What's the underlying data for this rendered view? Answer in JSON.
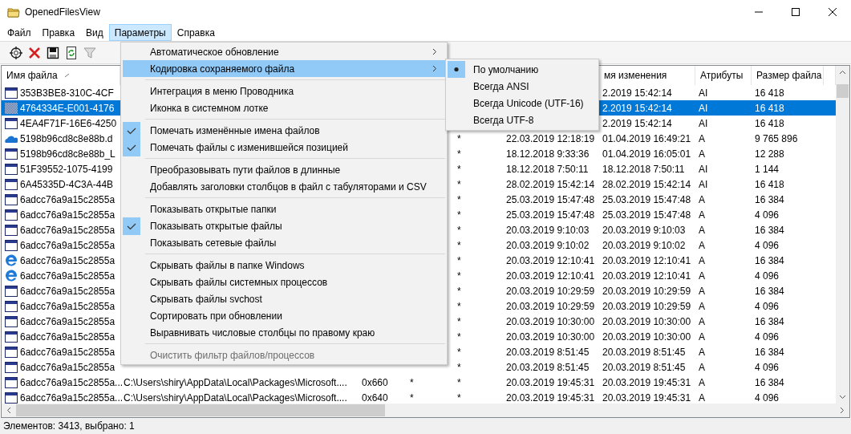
{
  "window": {
    "title": "OpenedFilesView"
  },
  "menu_bar": [
    {
      "label": "Файл",
      "selected": false
    },
    {
      "label": "Правка",
      "selected": false
    },
    {
      "label": "Вид",
      "selected": false
    },
    {
      "label": "Параметры",
      "selected": true
    },
    {
      "label": "Справка",
      "selected": false
    }
  ],
  "menu": {
    "items": [
      {
        "kind": "submenu",
        "label": "Автоматическое обновление",
        "selected": false
      },
      {
        "kind": "submenu",
        "label": "Кодировка сохраняемого файла",
        "selected": true
      },
      {
        "kind": "separator"
      },
      {
        "kind": "item",
        "label": "Интеграция в меню Проводника",
        "checked": false,
        "selected": false,
        "disabled": false
      },
      {
        "kind": "item",
        "label": "Иконка в системном лотке",
        "checked": false,
        "selected": false,
        "disabled": false
      },
      {
        "kind": "separator"
      },
      {
        "kind": "item",
        "label": "Помечать изменённые имена файлов",
        "checked": true,
        "selected": false,
        "disabled": false
      },
      {
        "kind": "item",
        "label": "Помечать файлы с изменившейся позицией",
        "checked": true,
        "selected": false,
        "disabled": false
      },
      {
        "kind": "separator"
      },
      {
        "kind": "item",
        "label": "Преобразовывать пути файлов в длинные",
        "checked": false,
        "selected": false,
        "disabled": false
      },
      {
        "kind": "item",
        "label": "Добавлять заголовки столбцов в файл с табуляторами и CSV",
        "checked": false,
        "selected": false,
        "disabled": false
      },
      {
        "kind": "separator"
      },
      {
        "kind": "item",
        "label": "Показывать открытые папки",
        "checked": false,
        "selected": false,
        "disabled": false
      },
      {
        "kind": "item",
        "label": "Показывать открытые файлы",
        "checked": true,
        "selected": false,
        "disabled": false
      },
      {
        "kind": "item",
        "label": "Показывать сетевые файлы",
        "checked": false,
        "selected": false,
        "disabled": false
      },
      {
        "kind": "separator"
      },
      {
        "kind": "item",
        "label": "Скрывать файлы в папке Windows",
        "checked": false,
        "selected": false,
        "disabled": false
      },
      {
        "kind": "item",
        "label": "Скрывать файлы системных процессов",
        "checked": false,
        "selected": false,
        "disabled": false
      },
      {
        "kind": "item",
        "label": "Скрывать файлы svchost",
        "checked": false,
        "selected": false,
        "disabled": false
      },
      {
        "kind": "item",
        "label": "Сортировать при обновлении",
        "checked": false,
        "selected": false,
        "disabled": false
      },
      {
        "kind": "item",
        "label": "Выравнивать числовые столбцы по правому краю",
        "checked": false,
        "selected": false,
        "disabled": false
      },
      {
        "kind": "separator"
      },
      {
        "kind": "item",
        "label": "Очистить фильтр файлов/процессов",
        "checked": false,
        "selected": false,
        "disabled": true
      }
    ]
  },
  "submenu": {
    "items": [
      {
        "label": "По умолчанию",
        "selected": true
      },
      {
        "label": "Всегда ANSI",
        "selected": false
      },
      {
        "label": "Всегда Unicode (UTF-16)",
        "selected": false
      },
      {
        "label": "Всегда UTF-8",
        "selected": false
      }
    ]
  },
  "table": {
    "columns": [
      {
        "label": "Имя файла",
        "sorted": true
      },
      {
        "label": "мя изменения",
        "sorted": false
      },
      {
        "label": "Атрибуты",
        "sorted": false
      },
      {
        "label": "Размер файла",
        "sorted": false
      }
    ],
    "rows": [
      {
        "kind": "window",
        "selected": false,
        "name": "353B3BE8-310C-4CF",
        "modified": "2.2019 15:42:14",
        "attributes": "AI",
        "size": "16 418"
      },
      {
        "kind": "pattern",
        "selected": true,
        "name": "4764334E-E001-4176",
        "modified": "2.2019 15:42:14",
        "attributes": "AI",
        "size": "16 418"
      },
      {
        "kind": "window",
        "selected": false,
        "name": "4EA4F71F-16E6-4250",
        "modified": "2.2019 15:42:14",
        "attributes": "AI",
        "size": "16 418"
      },
      {
        "kind": "cloud",
        "selected": false,
        "name": "5198b96cd8c8e88b.d",
        "column_5": "*",
        "column_6": "22.03.2019 12:18:19",
        "modified": "01.04.2019 16:49:21",
        "attributes": "A",
        "size": "9 765 896"
      },
      {
        "kind": "window",
        "selected": false,
        "name": "5198b96cd8c8e88b_L",
        "column_5": "*",
        "column_6": "18.12.2018 9:33:36",
        "modified": "01.04.2019 16:05:01",
        "attributes": "A",
        "size": "12 288"
      },
      {
        "kind": "window",
        "selected": false,
        "name": "51F39552-1075-4199",
        "column_5": "*",
        "column_6": "18.12.2018 7:50:11",
        "modified": "18.12.2018 7:50:11",
        "attributes": "AI",
        "size": "1 144"
      },
      {
        "kind": "window",
        "selected": false,
        "name": "6A45335D-4C3A-44B",
        "column_5": "*",
        "column_6": "28.02.2019 15:42:14",
        "modified": "28.02.2019 15:42:14",
        "attributes": "AI",
        "size": "16 418"
      },
      {
        "kind": "window",
        "selected": false,
        "name": "6adcc76a9a15c2855a",
        "column_5": "*",
        "column_6": "25.03.2019 15:47:48",
        "modified": "25.03.2019 15:47:48",
        "attributes": "A",
        "size": "16 384"
      },
      {
        "kind": "window",
        "selected": false,
        "name": "6adcc76a9a15c2855a",
        "column_5": "*",
        "column_6": "25.03.2019 15:47:48",
        "modified": "25.03.2019 15:47:48",
        "attributes": "A",
        "size": "4 096"
      },
      {
        "kind": "window",
        "selected": false,
        "name": "6adcc76a9a15c2855a",
        "column_5": "*",
        "column_6": "20.03.2019 9:10:03",
        "modified": "20.03.2019 9:10:03",
        "attributes": "A",
        "size": "16 384"
      },
      {
        "kind": "window",
        "selected": false,
        "name": "6adcc76a9a15c2855a",
        "column_5": "*",
        "column_6": "20.03.2019 9:10:02",
        "modified": "20.03.2019 9:10:02",
        "attributes": "A",
        "size": "4 096"
      },
      {
        "kind": "browser",
        "selected": false,
        "name": "6adcc76a9a15c2855a",
        "column_5": "*",
        "column_6": "20.03.2019 12:10:41",
        "modified": "20.03.2019 12:10:41",
        "attributes": "A",
        "size": "16 384"
      },
      {
        "kind": "browser",
        "selected": false,
        "name": "6adcc76a9a15c2855a",
        "column_5": "*",
        "column_6": "20.03.2019 12:10:41",
        "modified": "20.03.2019 12:10:41",
        "attributes": "A",
        "size": "4 096"
      },
      {
        "kind": "window",
        "selected": false,
        "name": "6adcc76a9a15c2855a",
        "column_5": "*",
        "column_6": "20.03.2019 10:29:59",
        "modified": "20.03.2019 10:29:59",
        "attributes": "A",
        "size": "16 384"
      },
      {
        "kind": "window",
        "selected": false,
        "name": "6adcc76a9a15c2855a",
        "column_5": "*",
        "column_6": "20.03.2019 10:29:59",
        "modified": "20.03.2019 10:29:59",
        "attributes": "A",
        "size": "4 096"
      },
      {
        "kind": "window",
        "selected": false,
        "name": "6adcc76a9a15c2855a",
        "column_5": "*",
        "column_6": "20.03.2019 10:30:00",
        "modified": "20.03.2019 10:30:00",
        "attributes": "A",
        "size": "16 384"
      },
      {
        "kind": "window",
        "selected": false,
        "name": "6adcc76a9a15c2855a",
        "column_5": "*",
        "column_6": "20.03.2019 10:30:00",
        "modified": "20.03.2019 10:30:00",
        "attributes": "A",
        "size": "4 096"
      },
      {
        "kind": "window",
        "selected": false,
        "name": "6adcc76a9a15c2855a",
        "column_5": "*",
        "column_6": "20.03.2019 8:51:45",
        "modified": "20.03.2019 8:51:45",
        "attributes": "A",
        "size": "16 384"
      },
      {
        "kind": "window",
        "selected": false,
        "name": "6adcc76a9a15c2855a",
        "column_5": "*",
        "column_6": "20.03.2019 8:51:45",
        "modified": "20.03.2019 8:51:45",
        "attributes": "A",
        "size": "4 096"
      },
      {
        "kind": "window",
        "selected": false,
        "name": "6adcc76a9a15c2855a...",
        "column_2": "C:\\Users\\shiry\\AppData\\Local\\Packages\\Microsoft....",
        "column_3": "0x660",
        "column_4": "*",
        "column_5": "*",
        "column_6": "20.03.2019 19:45:31",
        "modified": "20.03.2019 19:45:31",
        "attributes": "A",
        "size": "16 384"
      },
      {
        "kind": "window",
        "selected": false,
        "name": "6adcc76a9a15c2855a...",
        "column_2": "C:\\Users\\shiry\\AppData\\Local\\Packages\\Microsoft....",
        "column_3": "0x640",
        "column_4": "*",
        "column_5": "*",
        "column_6": "20.03.2019 19:45:31",
        "modified": "20.03.2019 19:45:31",
        "attributes": "A",
        "size": "4 096"
      }
    ]
  },
  "status_bar": "Элементов: 3413, выбрано: 1"
}
